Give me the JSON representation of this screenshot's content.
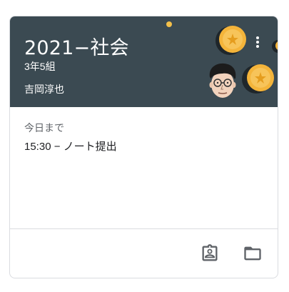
{
  "card": {
    "title": "2021−社会",
    "section": "3年5組",
    "teacher": "吉岡淳也",
    "due_label": "今日まで",
    "due_item": "15:30 − ノート提出"
  },
  "icons": {
    "more": "more-vertical-icon",
    "work": "assignment-ind-icon",
    "folder": "folder-icon"
  },
  "colors": {
    "header_bg": "#3b4a52",
    "coin": "#f4b43a",
    "icon_gray": "#5f6368"
  }
}
